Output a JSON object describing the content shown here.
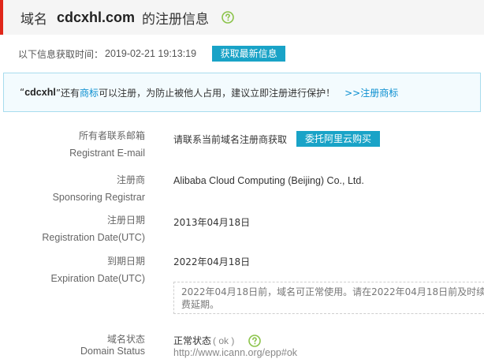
{
  "header": {
    "prefix": "域名",
    "domain": "cdcxhl.com",
    "suffix": "的注册信息",
    "help_icon": "question-circle-icon",
    "accent_color": "#e0271a"
  },
  "update": {
    "label": "以下信息获取时间：",
    "time": "2019-02-21 19:13:19",
    "button": "获取最新信息"
  },
  "notice": {
    "open_quote": "“",
    "name": "cdcxhl",
    "text1": "”还有",
    "link1": "商标",
    "text2": "可以注册，为防止被他人占用，建议立即注册进行保护！",
    "link2": ">>注册商标"
  },
  "rows": {
    "email": {
      "label_cn": "所有者联系邮箱",
      "label_en": "Registrant E-mail",
      "value": "请联系当前域名注册商获取",
      "button": "委托阿里云购买"
    },
    "registrar": {
      "label_cn": "注册商",
      "label_en": "Sponsoring Registrar",
      "value": "Alibaba Cloud Computing (Beijing) Co., Ltd."
    },
    "registration": {
      "label_cn": "注册日期",
      "label_en": "Registration Date(UTC)",
      "value": "2013年04月18日"
    },
    "expiration": {
      "label_cn": "到期日期",
      "label_en": "Expiration Date(UTC)",
      "value": "2022年04月18日",
      "note": "2022年04月18日前，域名可正常使用。请在2022年04月18日前及时续费延期。"
    },
    "status": {
      "label_cn": "域名状态",
      "label_en": "Domain Status",
      "value": "正常状态",
      "code": "( ok )",
      "help_icon": "question-circle-icon",
      "url": "http://www.icann.org/epp#ok"
    }
  },
  "colors": {
    "teal_button": "#19a3c7",
    "link": "#0b8fd0",
    "help_icon": "#8bc34a",
    "notice_bg": "#f3fbfe",
    "notice_border": "#a8dcee"
  }
}
